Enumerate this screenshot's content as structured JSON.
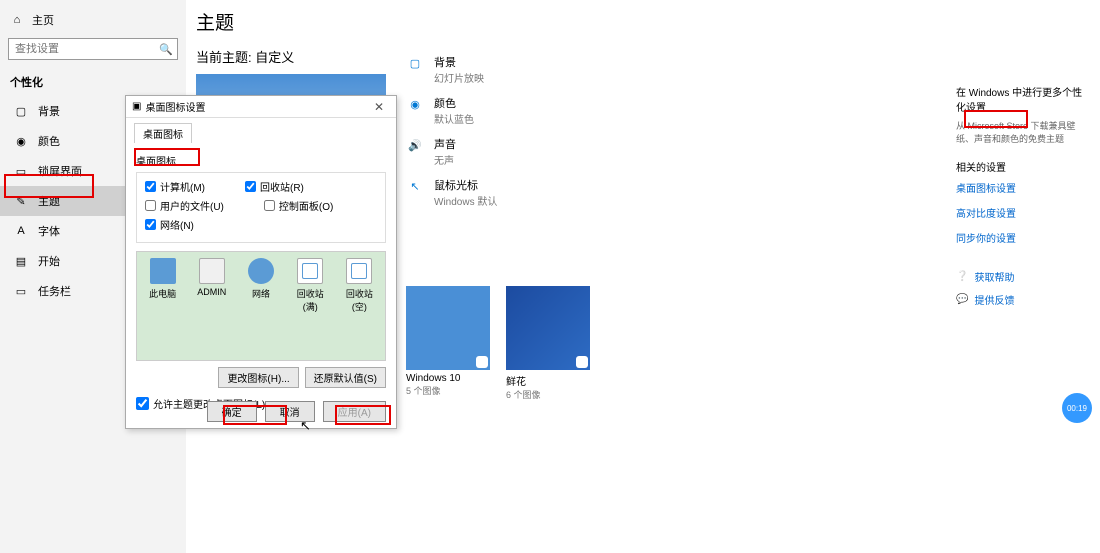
{
  "sidebar": {
    "home": "主页",
    "search_placeholder": "查找设置",
    "section": "个性化",
    "items": [
      {
        "label": "背景"
      },
      {
        "label": "颜色"
      },
      {
        "label": "锁屏界面"
      },
      {
        "label": "主题"
      },
      {
        "label": "字体"
      },
      {
        "label": "开始"
      },
      {
        "label": "任务栏"
      }
    ]
  },
  "main": {
    "title": "主题",
    "subtitle": "当前主题: 自定义",
    "options": [
      {
        "t1": "背景",
        "t2": "幻灯片放映"
      },
      {
        "t1": "颜色",
        "t2": "默认蓝色"
      },
      {
        "t1": "声音",
        "t2": "无声"
      },
      {
        "t1": "鼠标光标",
        "t2": "Windows 默认"
      }
    ],
    "cards": [
      {
        "name": "Windows 10",
        "sub": "5 个图像"
      },
      {
        "name": "鲜花",
        "sub": "6 个图像"
      }
    ]
  },
  "right": {
    "title": "在 Windows 中进行更多个性化设置",
    "desc": "从 Microsoft Store 下载兼具壁纸、声音和颜色的免费主题",
    "sec1": "相关的设置",
    "links": [
      "桌面图标设置",
      "高对比度设置",
      "同步你的设置"
    ],
    "help": "获取帮助",
    "feedback": "提供反馈"
  },
  "dialog": {
    "title": "桌面图标设置",
    "tab": "桌面图标",
    "group": "桌面图标",
    "chk_computer": "计算机(M)",
    "chk_recycle": "回收站(R)",
    "chk_userfiles": "用户的文件(U)",
    "chk_control": "控制面板(O)",
    "chk_network": "网络(N)",
    "icons": [
      "此电脑",
      "ADMIN",
      "网络",
      "回收站(满)",
      "回收站(空)"
    ],
    "btn_change": "更改图标(H)...",
    "btn_restore": "还原默认值(S)",
    "allow": "允许主题更改桌面图标(L)",
    "ok": "确定",
    "cancel": "取消",
    "apply": "应用(A)"
  },
  "timer": "00:19"
}
